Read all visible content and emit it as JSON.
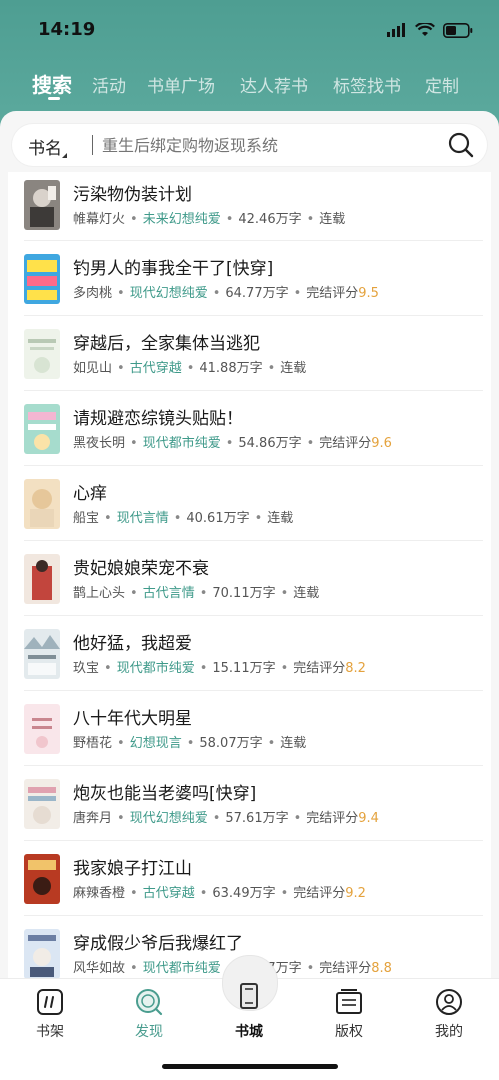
{
  "status": {
    "time": "14:19"
  },
  "tabs": [
    {
      "label": "搜索",
      "active": true
    },
    {
      "label": "活动",
      "active": false
    },
    {
      "label": "书单广场",
      "active": false
    },
    {
      "label": "达人荐书",
      "active": false
    },
    {
      "label": "标签找书",
      "active": false
    },
    {
      "label": "定制",
      "active": false
    }
  ],
  "search": {
    "type_label": "书名",
    "placeholder": "重生后绑定购物返现系统",
    "icon": "search-icon"
  },
  "books": [
    {
      "title": "污染物伪装计划",
      "author": "帷幕灯火",
      "genre": "未来幻想纯爱",
      "words": "42.46万字",
      "status": "连载",
      "score_label": "",
      "score": "",
      "cover_color": "#6d6a66"
    },
    {
      "title": "钓男人的事我全干了[快穿]",
      "author": "多肉桃",
      "genre": "现代幻想纯爱",
      "words": "64.77万字",
      "status": "完结评分",
      "score_label": "完结评分",
      "score": "9.5",
      "cover_color": "#3fa7e0"
    },
    {
      "title": "穿越后，全家集体当逃犯",
      "author": "如见山",
      "genre": "古代穿越",
      "words": "41.88万字",
      "status": "连载",
      "score_label": "",
      "score": "",
      "cover_color": "#e9efe6"
    },
    {
      "title": "请规避恋综镜头贴贴！",
      "author": "黑夜长明",
      "genre": "现代都市纯爱",
      "words": "54.86万字",
      "status": "完结评分",
      "score_label": "完结评分",
      "score": "9.6",
      "cover_color": "#9fd6c6"
    },
    {
      "title": "心痒",
      "author": "船宝",
      "genre": "现代言情",
      "words": "40.61万字",
      "status": "连载",
      "score_label": "",
      "score": "",
      "cover_color": "#f0d7b2"
    },
    {
      "title": "贵妃娘娘荣宠不衰",
      "author": "鹊上心头",
      "genre": "古代言情",
      "words": "70.11万字",
      "status": "连载",
      "score_label": "",
      "score": "",
      "cover_color": "#c2453d"
    },
    {
      "title": "他好猛，我超爱",
      "author": "玖宝",
      "genre": "现代都市纯爱",
      "words": "15.11万字",
      "status": "完结评分",
      "score_label": "完结评分",
      "score": "8.2",
      "cover_color": "#d9e3e7"
    },
    {
      "title": "八十年代大明星",
      "author": "野梧花",
      "genre": "幻想现言",
      "words": "58.07万字",
      "status": "连载",
      "score_label": "",
      "score": "",
      "cover_color": "#f6dde2"
    },
    {
      "title": "炮灰也能当老婆吗[快穿]",
      "author": "唐奔月",
      "genre": "现代幻想纯爱",
      "words": "57.61万字",
      "status": "完结评分",
      "score_label": "完结评分",
      "score": "9.4",
      "cover_color": "#efe9e2"
    },
    {
      "title": "我家娘子打江山",
      "author": "麻辣香橙",
      "genre": "古代穿越",
      "words": "63.49万字",
      "status": "完结评分",
      "score_label": "完结评分",
      "score": "9.2",
      "cover_color": "#b83a22"
    },
    {
      "title": "穿成假少爷后我爆红了",
      "author": "风华如故",
      "genre": "现代都市纯爱",
      "words": "76.67万字",
      "status": "完结评分",
      "score_label": "完结评分",
      "score": "8.8",
      "cover_color": "#d7e3f2"
    }
  ],
  "nav": [
    {
      "label": "书架",
      "icon": "bookshelf-icon",
      "active": false
    },
    {
      "label": "发现",
      "icon": "discover-icon",
      "active": true
    },
    {
      "label": "书城",
      "icon": "bookstore-icon",
      "active": false
    },
    {
      "label": "版权",
      "icon": "copyright-icon",
      "active": false
    },
    {
      "label": "我的",
      "icon": "profile-icon",
      "active": false
    }
  ],
  "colors": {
    "accent": "#4a9d8f",
    "header": "#5aa89c",
    "score": "#e4a23d"
  }
}
